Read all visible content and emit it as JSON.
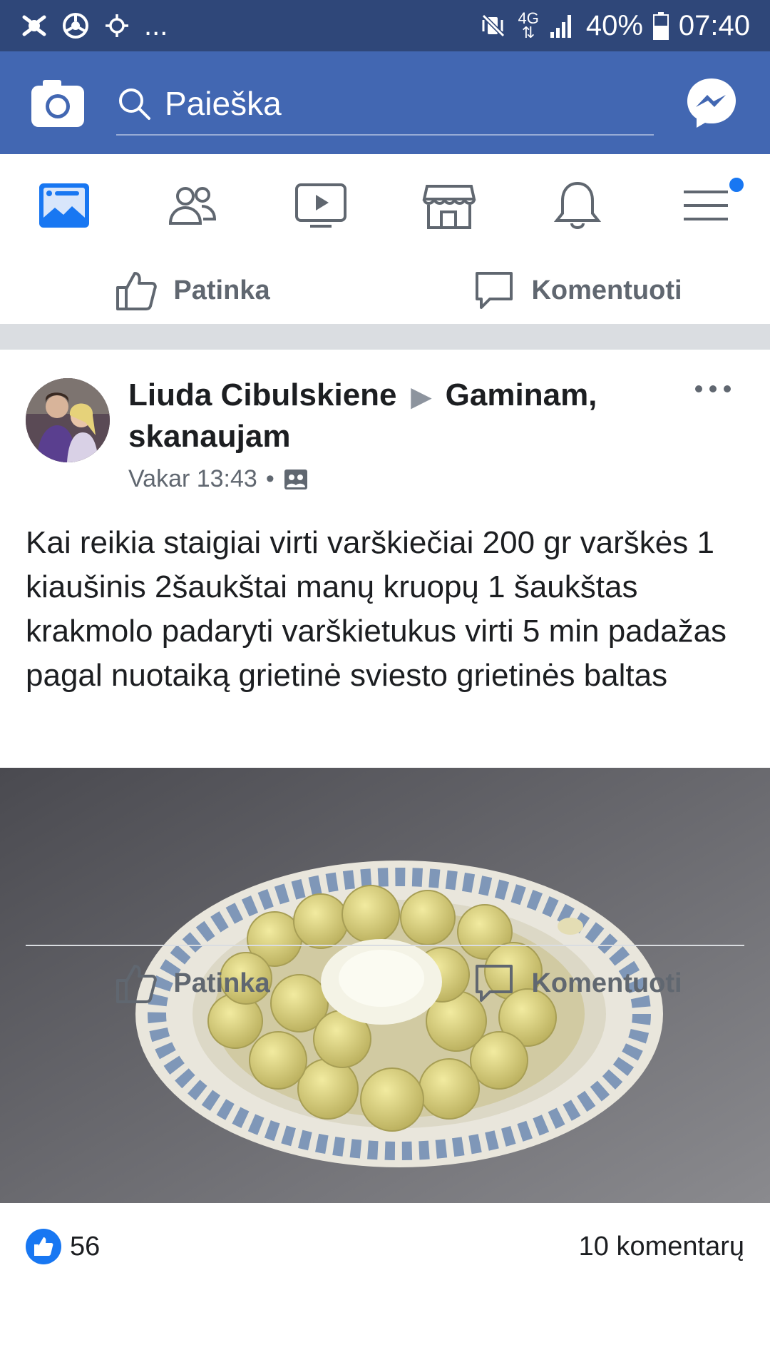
{
  "status_bar": {
    "dots": "...",
    "network": "4G",
    "battery": "40%",
    "time": "07:40"
  },
  "header": {
    "search_placeholder": "Paieška"
  },
  "nav": {
    "tabs": [
      "news-feed",
      "friends",
      "watch",
      "marketplace",
      "notifications",
      "menu"
    ],
    "active": "news-feed"
  },
  "previous_post": {
    "like_label": "Patinka",
    "comment_label": "Komentuoti"
  },
  "post": {
    "author": "Liuda Cibulskiene",
    "group": "Gaminam, skanaujam",
    "timestamp": "Vakar 13:43",
    "text": "Kai reikia staigiai virti varškiečiai 200 gr varškės 1 kiaušinis 2šaukštai manų kruopų 1 šaukštas krakmolo padaryti varškietukus virti 5 min padažas pagal nuotaiką grietinė  sviesto grietinės baltas",
    "likes": "56",
    "comments": "10 komentarų",
    "like_label": "Patinka",
    "comment_label": "Komentuoti"
  },
  "colors": {
    "status_bar": "#2f4779",
    "header": "#4267b2",
    "accent": "#1877f2",
    "separator": "#dadde1"
  }
}
